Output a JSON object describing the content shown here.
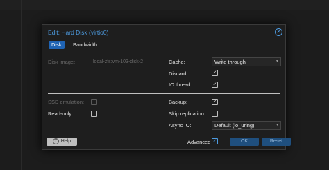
{
  "dialog": {
    "title": "Edit: Hard Disk (virtio0)",
    "close_icon": "close-circle-icon"
  },
  "tabs": [
    {
      "label": "Disk",
      "active": true
    },
    {
      "label": "Bandwidth",
      "active": false
    }
  ],
  "left": {
    "disk_image_label": "Disk image:",
    "disk_image_value": "local-zfs:vm-103-disk-2",
    "ssd_label": "SSD emulation:",
    "ssd_checked": false,
    "readonly_label": "Read-only:",
    "readonly_checked": false
  },
  "right": {
    "cache_label": "Cache:",
    "cache_value": "Write through",
    "discard_label": "Discard:",
    "discard_checked": true,
    "iothread_label": "IO thread:",
    "iothread_checked": true,
    "backup_label": "Backup:",
    "backup_checked": true,
    "skip_repl_label": "Skip replication:",
    "skip_repl_checked": false,
    "async_label": "Async IO:",
    "async_value": "Default (io_uring)"
  },
  "footer": {
    "help_label": "Help",
    "advanced_label": "Advanced",
    "advanced_checked": true,
    "ok_label": "OK",
    "reset_label": "Reset"
  },
  "glyphs": {
    "check": "✓",
    "help": "?",
    "close": "✕",
    "arrow": "▾"
  },
  "colors": {
    "accent": "#4d9be0",
    "tab_active": "#1f63b3",
    "dialog_bg": "#1e1e1e"
  }
}
